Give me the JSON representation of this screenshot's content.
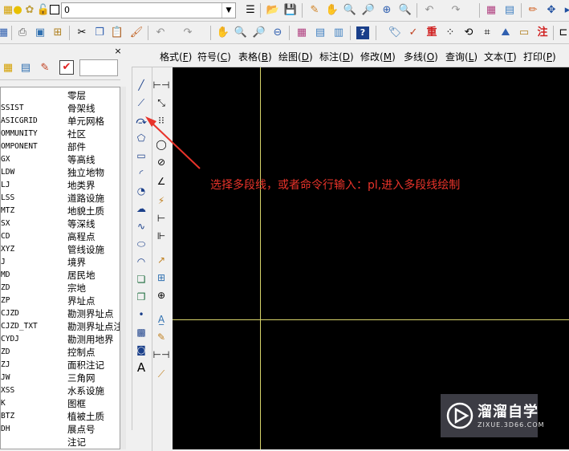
{
  "toolbar": {
    "layer_combo_value": "0"
  },
  "menu": {
    "items": [
      {
        "label": "格式",
        "key": "F"
      },
      {
        "label": "符号",
        "key": "C"
      },
      {
        "label": "表格",
        "key": "B"
      },
      {
        "label": "绘图",
        "key": "D"
      },
      {
        "label": "标注",
        "key": "D"
      },
      {
        "label": "修改",
        "key": "M"
      },
      {
        "label": "多线",
        "key": "O"
      },
      {
        "label": "查询",
        "key": "L"
      },
      {
        "label": "文本",
        "key": "T"
      },
      {
        "label": "打印",
        "key": "P"
      }
    ],
    "close_glyph": "×"
  },
  "layers": {
    "header_desc": "零层",
    "rows": [
      {
        "name": "SSIST",
        "desc": "骨架线"
      },
      {
        "name": "ASICGRID",
        "desc": "单元网格"
      },
      {
        "name": "OMMUNITY",
        "desc": "社区"
      },
      {
        "name": "OMPONENT",
        "desc": "部件"
      },
      {
        "name": "GX",
        "desc": "等高线"
      },
      {
        "name": "LDW",
        "desc": "独立地物"
      },
      {
        "name": "LJ",
        "desc": "地类界"
      },
      {
        "name": "LSS",
        "desc": "道路设施"
      },
      {
        "name": "MTZ",
        "desc": "地貌土质"
      },
      {
        "name": "SX",
        "desc": "等深线"
      },
      {
        "name": "CD",
        "desc": "高程点"
      },
      {
        "name": "XYZ",
        "desc": "管线设施"
      },
      {
        "name": "J",
        "desc": "境界"
      },
      {
        "name": "MD",
        "desc": "居民地"
      },
      {
        "name": "ZD",
        "desc": "宗地"
      },
      {
        "name": "ZP",
        "desc": "界址点"
      },
      {
        "name": "CJZD",
        "desc": "勘测界址点"
      },
      {
        "name": "CJZD_TXT",
        "desc": "勘测界址点注"
      },
      {
        "name": "CYDJ",
        "desc": "勘测用地界"
      },
      {
        "name": "ZD",
        "desc": "控制点"
      },
      {
        "name": "ZJ",
        "desc": "面积注记"
      },
      {
        "name": "JW",
        "desc": "三角网"
      },
      {
        "name": "XSS",
        "desc": "水系设施"
      },
      {
        "name": "K",
        "desc": "图框"
      },
      {
        "name": "BTZ",
        "desc": "植被土质"
      },
      {
        "name": "DH",
        "desc": "展点号"
      },
      {
        "name": "",
        "desc": "注记"
      }
    ]
  },
  "annotation": {
    "text": "选择多段线，或者命令行输入：pl,进入多段线绘制",
    "color": "#e8332a"
  },
  "watermark": {
    "title": "溜溜自学",
    "url": "ZIXUE.3D66.COM"
  },
  "colors": {
    "canvas_bg": "#000000",
    "crosshair": "#d8d46a"
  }
}
